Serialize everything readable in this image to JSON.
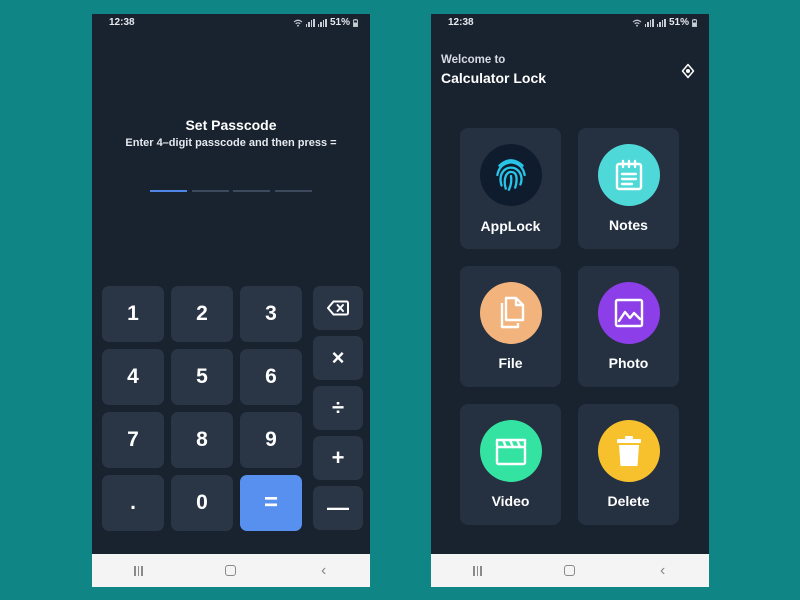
{
  "status_bar": {
    "time": "12:38",
    "battery": "51%"
  },
  "passcode": {
    "title": "Set Passcode",
    "subtitle": "Enter 4–digit passcode and then press ="
  },
  "keypad": {
    "numbers": [
      "1",
      "2",
      "3",
      "4",
      "5",
      "6",
      "7",
      "8",
      "9",
      ".",
      "0",
      "="
    ],
    "operators": [
      "⌫",
      "×",
      "÷",
      "+",
      "—"
    ]
  },
  "home": {
    "welcome": "Welcome to",
    "app_name": "Calculator Lock",
    "tiles": [
      {
        "label": "AppLock",
        "icon": "fingerprint-icon",
        "color": "#0f1c2d"
      },
      {
        "label": "Notes",
        "icon": "notes-icon",
        "color": "#4fd8d8"
      },
      {
        "label": "File",
        "icon": "file-icon",
        "color": "#f2b37c"
      },
      {
        "label": "Photo",
        "icon": "photo-icon",
        "color": "#8c3ee8"
      },
      {
        "label": "Video",
        "icon": "video-icon",
        "color": "#34e3a2"
      },
      {
        "label": "Delete",
        "icon": "trash-icon",
        "color": "#f7c12d"
      }
    ]
  },
  "colors": {
    "background": "#0f8585",
    "screen": "#19222f",
    "key": "#2a3545",
    "accent": "#5890f0"
  }
}
